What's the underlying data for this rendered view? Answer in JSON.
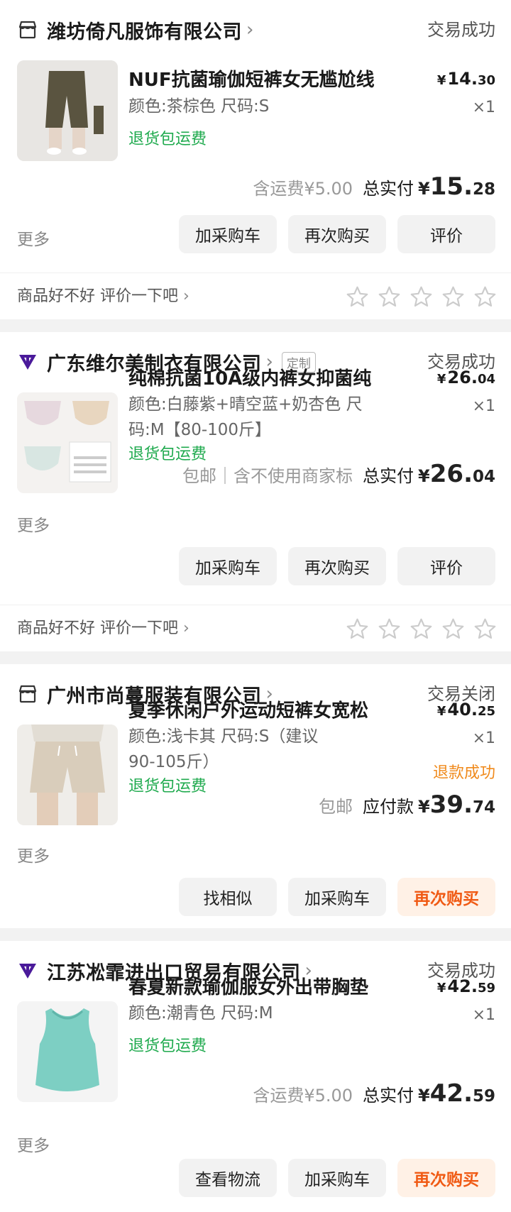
{
  "orders": [
    {
      "shop_name": "潍坊倚凡服饰有限公司",
      "shop_icon": "store-icon",
      "status": "交易成功",
      "title": "NUF抗菌瑜伽短裤女无尴尬线",
      "spec": "颜色:茶棕色 尺码:S",
      "refund_tip": "退货包运费",
      "price_int": "14.",
      "price_dec": "30",
      "qty": "×1",
      "shipping": "含运费¥5.00",
      "total_label": "总实付",
      "total_int": "15.",
      "total_dec": "28",
      "more": "更多",
      "buttons": [
        "加采购车",
        "再次购买",
        "评价"
      ],
      "review_prompt": "商品好不好 评价一下吧"
    },
    {
      "shop_name": "广东维尔美制衣有限公司",
      "shop_icon": "tmall-icon",
      "custom_tag": "定制",
      "status": "交易成功",
      "title": "纯棉抗菌10A级内裤女抑菌纯",
      "spec": "颜色:白藤紫+晴空蓝+奶杏色 尺码:M【80-100斤】",
      "refund_tip": "退货包运费",
      "price_int": "26.",
      "price_dec": "04",
      "qty": "×1",
      "shipping": "包邮｜含不使用商家标",
      "total_label": "总实付",
      "total_int": "26.",
      "total_dec": "04",
      "more": "更多",
      "buttons": [
        "加采购车",
        "再次购买",
        "评价"
      ],
      "review_prompt": "商品好不好 评价一下吧"
    },
    {
      "shop_name": "广州市尚蔓服装有限公司",
      "shop_icon": "store-icon",
      "status": "交易关闭",
      "title": "夏季休闲户外运动短裤女宽松",
      "spec": "颜色:浅卡其 尺码:S（建议90-105斤）",
      "refund_tip": "退货包运费",
      "price_int": "40.",
      "price_dec": "25",
      "qty": "×1",
      "refund_status": "退款成功",
      "shipping": "包邮",
      "total_label": "应付款",
      "total_int": "39.",
      "total_dec": "74",
      "more": "更多",
      "buttons": [
        "找相似",
        "加采购车",
        "再次购买"
      ]
    },
    {
      "shop_name": "江苏凇霏进出口贸易有限公司",
      "shop_icon": "tmall-icon",
      "status": "交易成功",
      "title": "春夏新款瑜伽服女外出带胸垫",
      "spec": "颜色:潮青色 尺码:M",
      "refund_tip": "退货包运费",
      "price_int": "42.",
      "price_dec": "59",
      "qty": "×1",
      "shipping": "含运费¥5.00",
      "total_label": "总实付",
      "total_int": "42.",
      "total_dec": "59",
      "more": "更多",
      "buttons": [
        "查看物流",
        "加采购车",
        "再次购买"
      ]
    }
  ],
  "currency": "¥",
  "colors": {
    "accent_orange": "#f05a14",
    "green": "#1faa4e",
    "refund_orange": "#f08a1c"
  }
}
